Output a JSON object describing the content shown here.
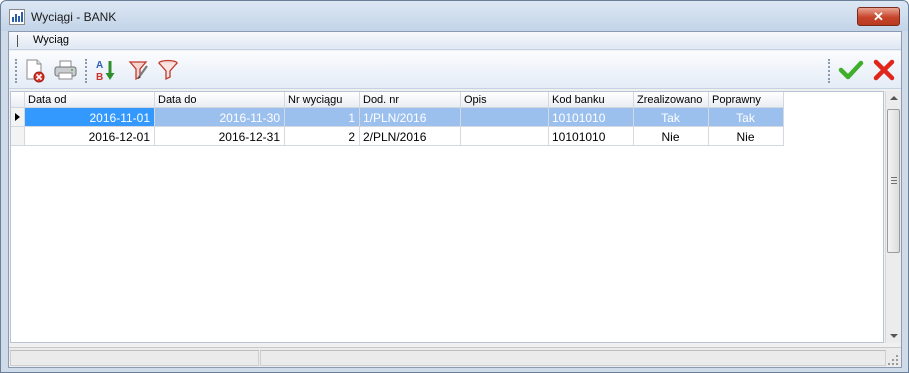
{
  "window": {
    "title": "Wyciągi - BANK",
    "close_glyph": "✕"
  },
  "menu": {
    "items": [
      {
        "label": "Wyciąg"
      }
    ]
  },
  "toolbar": {
    "buttons": [
      {
        "name": "delete-document-icon"
      },
      {
        "name": "print-icon"
      },
      {
        "name": "sort-az-icon"
      },
      {
        "name": "filter-edit-icon"
      },
      {
        "name": "filter-icon"
      },
      {
        "name": "confirm-check-icon"
      },
      {
        "name": "cancel-x-icon"
      }
    ],
    "colors": {
      "confirm": "#3fae2a",
      "cancel": "#e0261c"
    }
  },
  "grid": {
    "columns": [
      "Data od",
      "Data do",
      "Nr wyciągu",
      "Dod. nr",
      "Opis",
      "Kod banku",
      "Zrealizowano",
      "Poprawny"
    ],
    "rows": [
      {
        "data_od": "2016-11-01",
        "data_do": "2016-11-30",
        "nr": "1",
        "dod_nr": "1/PLN/2016",
        "opis": "",
        "kod_banku": "10101010",
        "zrealizowano": "Tak",
        "poprawny": "Tak",
        "selected": true
      },
      {
        "data_od": "2016-12-01",
        "data_do": "2016-12-31",
        "nr": "2",
        "dod_nr": "2/PLN/2016",
        "opis": "",
        "kod_banku": "10101010",
        "zrealizowano": "Nie",
        "poprawny": "Nie",
        "selected": false
      }
    ],
    "selection_color": "#9cc0ee"
  }
}
